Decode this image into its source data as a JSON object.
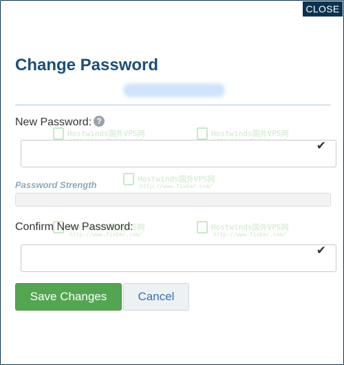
{
  "dialog": {
    "close_label": "CLOSE",
    "title": "Change Password",
    "account_email": "••••••••••••••"
  },
  "form": {
    "new_password_label": "New Password:",
    "help_glyph": "?",
    "new_password_value": "",
    "check_glyph": "✔",
    "strength_label": "Password Strength",
    "strength_level": 0,
    "confirm_password_label": "Confirm New Password:",
    "confirm_password_value": ""
  },
  "buttons": {
    "save_label": "Save Changes",
    "cancel_label": "Cancel"
  },
  "watermark": {
    "name": "Hostwinds国外VPS网",
    "url": "http://www.fixbar.com/"
  },
  "colors": {
    "close_bg": "#0b3350",
    "title": "#1b4f78",
    "save_bg": "#53a552",
    "cancel_text": "#3a6fb0",
    "strength_label": "#8fa8bd"
  },
  "icons": {
    "help": "help-icon",
    "valid": "check-icon"
  }
}
